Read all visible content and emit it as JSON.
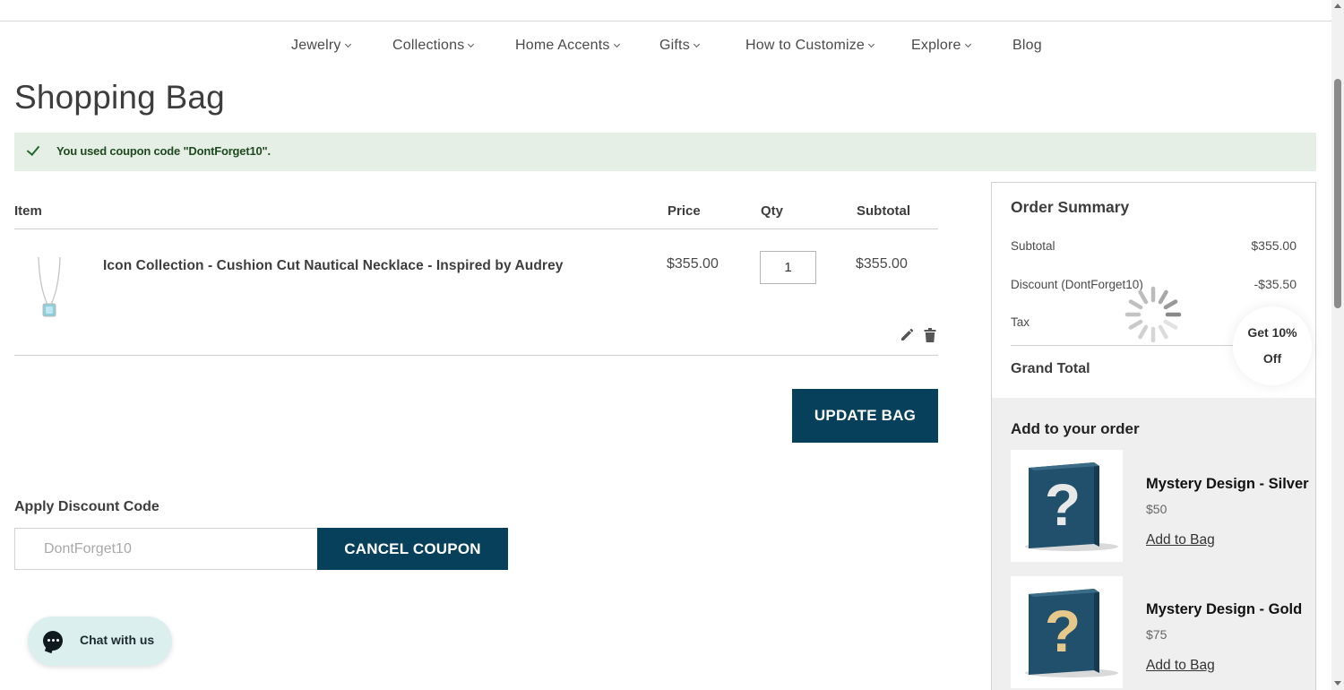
{
  "nav": {
    "items": [
      {
        "label": "Jewelry",
        "has_dropdown": true
      },
      {
        "label": "Collections",
        "has_dropdown": true
      },
      {
        "label": "Home Accents",
        "has_dropdown": true
      },
      {
        "label": "Gifts",
        "has_dropdown": true
      },
      {
        "label": "How to Customize",
        "has_dropdown": true
      },
      {
        "label": "Explore",
        "has_dropdown": true
      },
      {
        "label": "Blog",
        "has_dropdown": false
      }
    ]
  },
  "page": {
    "title": "Shopping Bag"
  },
  "notice": {
    "message": "You used coupon code \"DontForget10\"."
  },
  "cart": {
    "headers": {
      "item": "Item",
      "price": "Price",
      "qty": "Qty",
      "subtotal": "Subtotal"
    },
    "items": [
      {
        "name": "Icon Collection - Cushion Cut Nautical Necklace - Inspired by Audrey",
        "price": "$355.00",
        "qty": "1",
        "subtotal": "$355.00"
      }
    ],
    "update_label": "UPDATE BAG"
  },
  "discount": {
    "label": "Apply Discount Code",
    "code": "DontForget10",
    "cancel_label": "CANCEL COUPON"
  },
  "chat": {
    "label": "Chat with us"
  },
  "summary": {
    "title": "Order Summary",
    "subtotal_label": "Subtotal",
    "subtotal_value": "$355.00",
    "discount_label": "Discount (DontForget10)",
    "discount_value": "-$35.50",
    "tax_label": "Tax",
    "grand_total_label": "Grand Total"
  },
  "promo": {
    "line1": "Get 10%",
    "line2": "Off"
  },
  "upsell": {
    "title": "Add to your order",
    "items": [
      {
        "name": "Mystery Design - Silver",
        "price": "$50",
        "link": "Add to Bag"
      },
      {
        "name": "Mystery Design - Gold",
        "price": "$75",
        "link": "Add to Bag"
      }
    ]
  },
  "colors": {
    "primary_button": "#07405a",
    "notice_bg": "#e5efe5",
    "notice_text": "#1f4a1f",
    "silver_mark": "#e8e8e8",
    "gold_mark": "#e6c98a"
  }
}
